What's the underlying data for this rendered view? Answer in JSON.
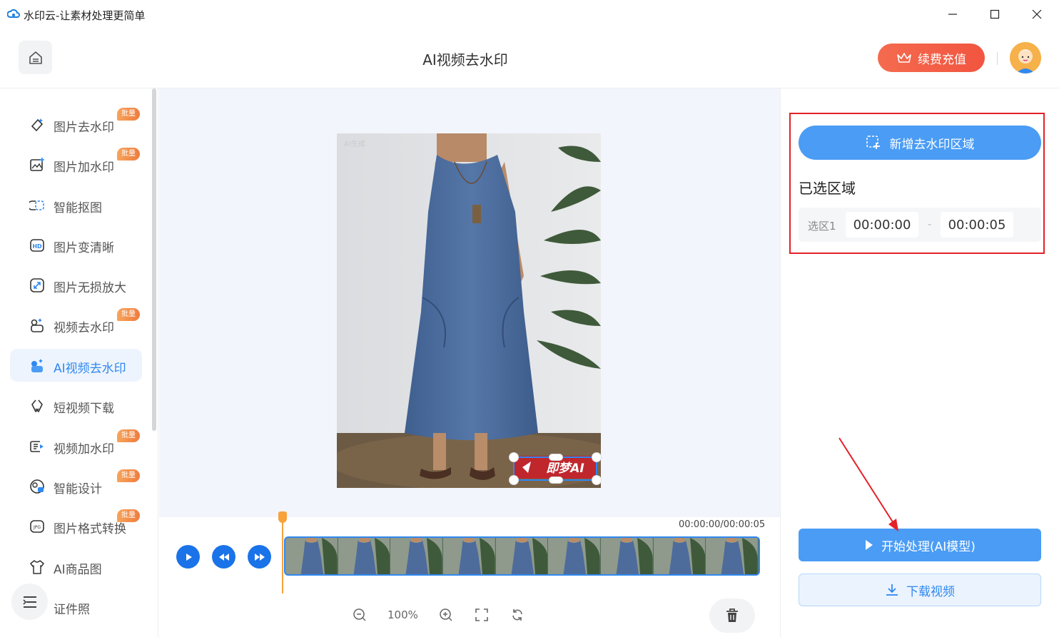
{
  "window": {
    "title": "水印云-让素材处理更简单"
  },
  "header": {
    "page_title": "AI视频去水印",
    "vip_label": "续费充值"
  },
  "sidebar": {
    "items": [
      {
        "label": "图片去水印",
        "badge": "批量",
        "icon": "eraser-icon"
      },
      {
        "label": "图片加水印",
        "badge": "批量",
        "icon": "image-add-icon"
      },
      {
        "label": "智能抠图",
        "badge": "",
        "icon": "cutout-icon"
      },
      {
        "label": "图片变清晰",
        "badge": "",
        "icon": "hd-icon"
      },
      {
        "label": "图片无损放大",
        "badge": "",
        "icon": "enlarge-icon"
      },
      {
        "label": "视频去水印",
        "badge": "批量",
        "icon": "video-eraser-icon"
      },
      {
        "label": "AI视频去水印",
        "badge": "",
        "icon": "ai-video-icon"
      },
      {
        "label": "短视频下载",
        "badge": "",
        "icon": "link-icon"
      },
      {
        "label": "视频加水印",
        "badge": "批量",
        "icon": "video-add-icon"
      },
      {
        "label": "智能设计",
        "badge": "批量",
        "icon": "design-icon"
      },
      {
        "label": "图片格式转换",
        "badge": "批量",
        "icon": "jpg-icon"
      },
      {
        "label": "AI商品图",
        "badge": "",
        "icon": "shirt-icon"
      },
      {
        "label": "证件照",
        "badge": "",
        "icon": "id-photo-icon"
      }
    ],
    "active_index": 6
  },
  "preview": {
    "watermark_text": "即梦AI",
    "corner_tag": "AI生成"
  },
  "timeline": {
    "time_display": "00:00:00/00:00:05",
    "zoom_level": "100%",
    "playhead_fraction": 0
  },
  "right_panel": {
    "add_region_label": "新增去水印区域",
    "selected_title": "已选区域",
    "regions": [
      {
        "name": "选区1",
        "start": "00:00:00",
        "end": "00:00:05"
      }
    ],
    "dash": "-",
    "start_label": "开始处理(AI模型)",
    "download_label": "下载视频"
  },
  "colors": {
    "accent": "#4a9cf5",
    "vip": "#f2553f",
    "badge": "#ee7c3f",
    "highlight_box": "#e32127"
  }
}
